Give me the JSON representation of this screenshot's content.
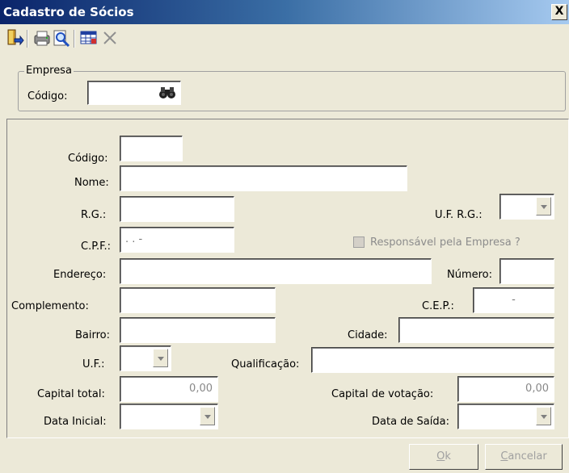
{
  "window": {
    "title": "Cadastro de Sócios",
    "close_symbol": "X"
  },
  "toolbar": {
    "buttons": [
      {
        "name": "exit",
        "icon": "exit-door-icon"
      },
      {
        "name": "print",
        "icon": "printer-icon"
      },
      {
        "name": "preview",
        "icon": "print-preview-icon"
      },
      {
        "name": "report",
        "icon": "report-grid-icon"
      },
      {
        "name": "delete",
        "icon": "close-x-icon"
      }
    ]
  },
  "empresa": {
    "legend": "Empresa",
    "codigo_label": "Código:",
    "codigo_value": ""
  },
  "form": {
    "codigo_label": "Código:",
    "nome_label": "Nome:",
    "rg_label": "R.G.:",
    "uf_rg_label": "U.F. R.G.:",
    "cpf_label": "C.P.F.:",
    "cpf_mask": " .   .   -",
    "responsavel_label": "Responsável pela Empresa ?",
    "endereco_label": "Endereço:",
    "numero_label": "Número:",
    "complemento_label": "Complemento:",
    "cep_label": "C.E.P.:",
    "cep_mask": "-",
    "bairro_label": "Bairro:",
    "cidade_label": "Cidade:",
    "uf_label": "U.F.:",
    "qualificacao_label": "Qualificação:",
    "capital_total_label": "Capital total:",
    "capital_total_value": "0,00",
    "capital_votacao_label": "Capital de votação:",
    "capital_votacao_value": "0,00",
    "data_inicial_label": "Data Inicial:",
    "data_saida_label": "Data de Saída:"
  },
  "buttons": {
    "ok_mnemonic": "O",
    "ok_rest": "k",
    "cancel_mnemonic": "C",
    "cancel_rest": "ancelar"
  }
}
